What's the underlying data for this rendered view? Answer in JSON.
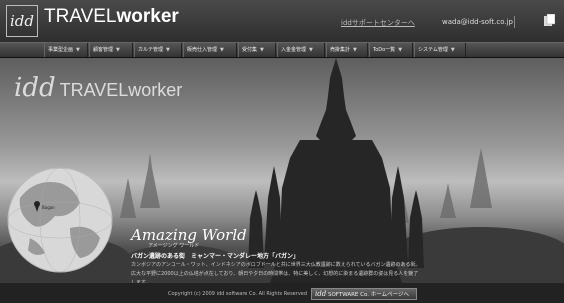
{
  "header": {
    "logo_text": "idd",
    "brand_light": "TRAVEL",
    "brand_bold": "worker",
    "support_link": "iddサポートセンターへ",
    "email": "wada@idd-soft.co.jp"
  },
  "nav": {
    "items": [
      {
        "label": "事業型企画"
      },
      {
        "label": "顧客管理"
      },
      {
        "label": "カルテ管理"
      },
      {
        "label": "販売仕入管理"
      },
      {
        "label": "受付集"
      },
      {
        "label": "入金金管理"
      },
      {
        "label": "売掛集計"
      },
      {
        "label": "ToDo一覧"
      },
      {
        "label": "システム管理"
      }
    ]
  },
  "hero": {
    "logo_text": "idd",
    "brand": "TRAVELworker",
    "map_label": "Bagan",
    "amazing_title": "Amazing World",
    "amazing_sub": "アメージング  ワールド",
    "caption_title": "バガン遺跡のある街　ミャンマー・マンダレー地方「バガン」",
    "caption_body": "カンボジアのアンコール・ワット、インドネシアのボロブドールと共に世界三大仏教遺跡に数えられているバガン遺跡のある街。広大な平野に2000以上の仏塔が点在しており、朝日や夕日の時間帯は、特に美しく、幻想的に染まる遺跡群の姿は見る人を魅了します。"
  },
  "footer": {
    "copyright": "Copyright (c) 2009 idd software Co. All Rights Reserved",
    "home_button_logo": "idd",
    "home_button_label": "SOFTWARE Co. ホームページへ"
  }
}
